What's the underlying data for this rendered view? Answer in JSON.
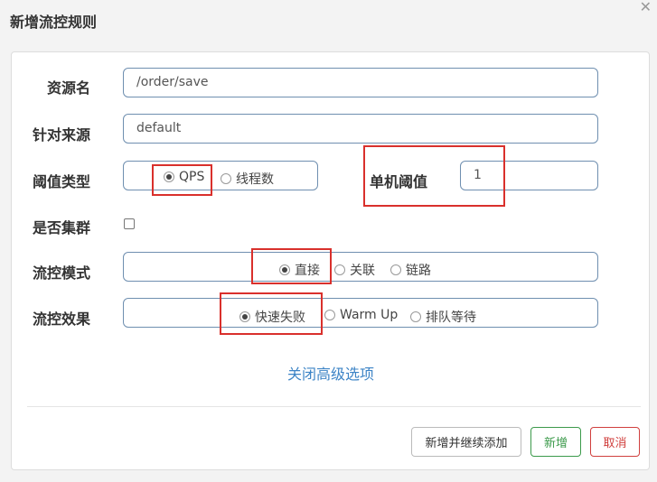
{
  "dialog": {
    "title": "新增流控规则",
    "close_glyph": "✕"
  },
  "form": {
    "resource": {
      "label": "资源名",
      "value": "/order/save"
    },
    "origin": {
      "label": "针对来源",
      "value": "default"
    },
    "threshold_type": {
      "label": "阈值类型",
      "options": [
        "QPS",
        "线程数"
      ],
      "selected": "QPS"
    },
    "single_threshold": {
      "label": "单机阈值",
      "value": "1"
    },
    "cluster": {
      "label": "是否集群",
      "checked": false
    },
    "flow_mode": {
      "label": "流控模式",
      "options": [
        "直接",
        "关联",
        "链路"
      ],
      "selected": "直接"
    },
    "flow_effect": {
      "label": "流控效果",
      "options": [
        "快速失败",
        "Warm Up",
        "排队等待"
      ],
      "selected": "快速失败"
    },
    "advanced_toggle": "关闭高级选项"
  },
  "footer": {
    "add_continue_label": "新增并继续添加",
    "add_label": "新增",
    "cancel_label": "取消"
  },
  "colors": {
    "highlight": "#d9302c",
    "link": "#3d84c6",
    "success": "#3c9a4b",
    "danger": "#d0403e"
  }
}
